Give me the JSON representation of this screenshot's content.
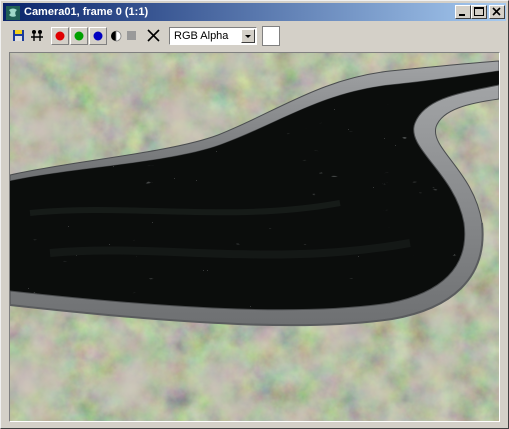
{
  "window": {
    "title": "Camera01, frame 0 (1:1)",
    "title_icon": "3ds-max-logo-icon"
  },
  "caption_buttons": [
    "minimize-icon",
    "maximize-icon",
    "close-icon"
  ],
  "toolbar": {
    "buttons": [
      {
        "name": "save-bitmap-button",
        "icon": "floppy-disk-icon"
      },
      {
        "name": "clone-window-button",
        "icon": "clone-icon"
      },
      {
        "name": "red-channel-button",
        "icon": "red-circle-icon",
        "color": "#e00000"
      },
      {
        "name": "green-channel-button",
        "icon": "green-circle-icon",
        "color": "#00a000"
      },
      {
        "name": "blue-channel-button",
        "icon": "blue-circle-icon",
        "color": "#0000c0"
      },
      {
        "name": "monochrome-button",
        "icon": "half-circle-icon"
      },
      {
        "name": "stop-button",
        "icon": "square-icon"
      },
      {
        "name": "clear-button",
        "icon": "x-icon"
      }
    ],
    "channel_dropdown": {
      "value": "RGB Alpha"
    },
    "color_swatch": {
      "color": "#ffffff"
    }
  },
  "viewport": {
    "content": "rendered camera view",
    "water_color": "#0b0d0c",
    "rim_color": "#8a8c8e",
    "terrain_color": "#7a8060"
  }
}
